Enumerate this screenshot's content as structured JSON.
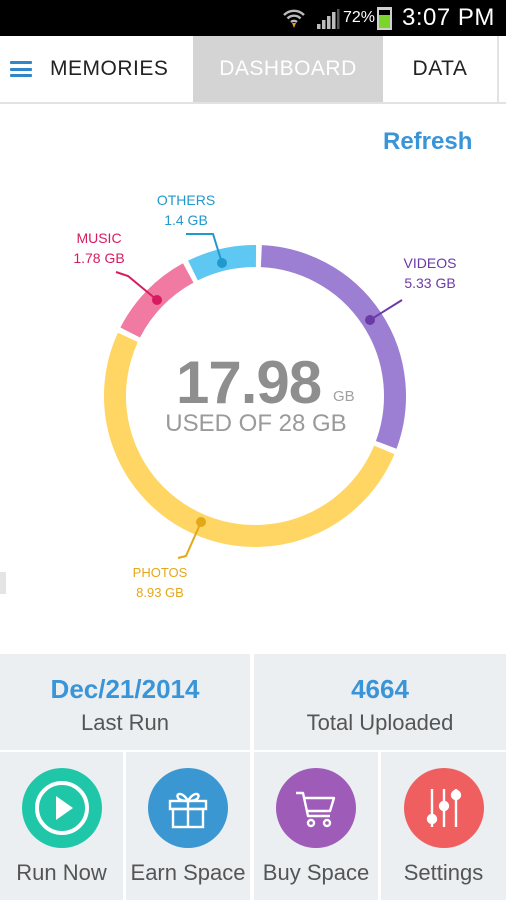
{
  "status_bar": {
    "battery_percent": "72%",
    "battery_level": 0.72,
    "time": "3:07 PM"
  },
  "tabs": {
    "memories": "MEMORIES",
    "dashboard": "DASHBOARD",
    "data": "DATA"
  },
  "refresh_label": "Refresh",
  "storage": {
    "used_value": "17.98",
    "used_unit": "GB",
    "used_caption": "USED OF 28 GB",
    "total_gb": 28
  },
  "chart_data": {
    "type": "pie",
    "variant": "donut",
    "categories": [
      "VIDEOS",
      "PHOTOS",
      "MUSIC",
      "OTHERS"
    ],
    "values": [
      5.33,
      8.93,
      1.78,
      1.4
    ],
    "unit": "GB",
    "colors": [
      "#9c7fd2",
      "#ffd664",
      "#f07aa2",
      "#5ec7f2"
    ],
    "labels": [
      {
        "name": "VIDEOS",
        "value": "5.33 GB",
        "color": "#6a3aa6"
      },
      {
        "name": "PHOTOS",
        "value": "8.93 GB",
        "color": "#e3a81a"
      },
      {
        "name": "MUSIC",
        "value": "1.78 GB",
        "color": "#d81b60"
      },
      {
        "name": "OTHERS",
        "value": "1.4 GB",
        "color": "#2299cc"
      }
    ]
  },
  "stats": {
    "last_run_value": "Dec/21/2014",
    "last_run_label": "Last Run",
    "uploaded_value": "4664",
    "uploaded_label": "Total Uploaded"
  },
  "actions": [
    {
      "label": "Run Now",
      "icon": "play-icon",
      "color": "#1fc7a8"
    },
    {
      "label": "Earn Space",
      "icon": "gift-icon",
      "color": "#3a97d2"
    },
    {
      "label": "Buy Space",
      "icon": "cart-icon",
      "color": "#9e5bb8"
    },
    {
      "label": "Settings",
      "icon": "sliders-icon",
      "color": "#ef5f5f"
    }
  ]
}
